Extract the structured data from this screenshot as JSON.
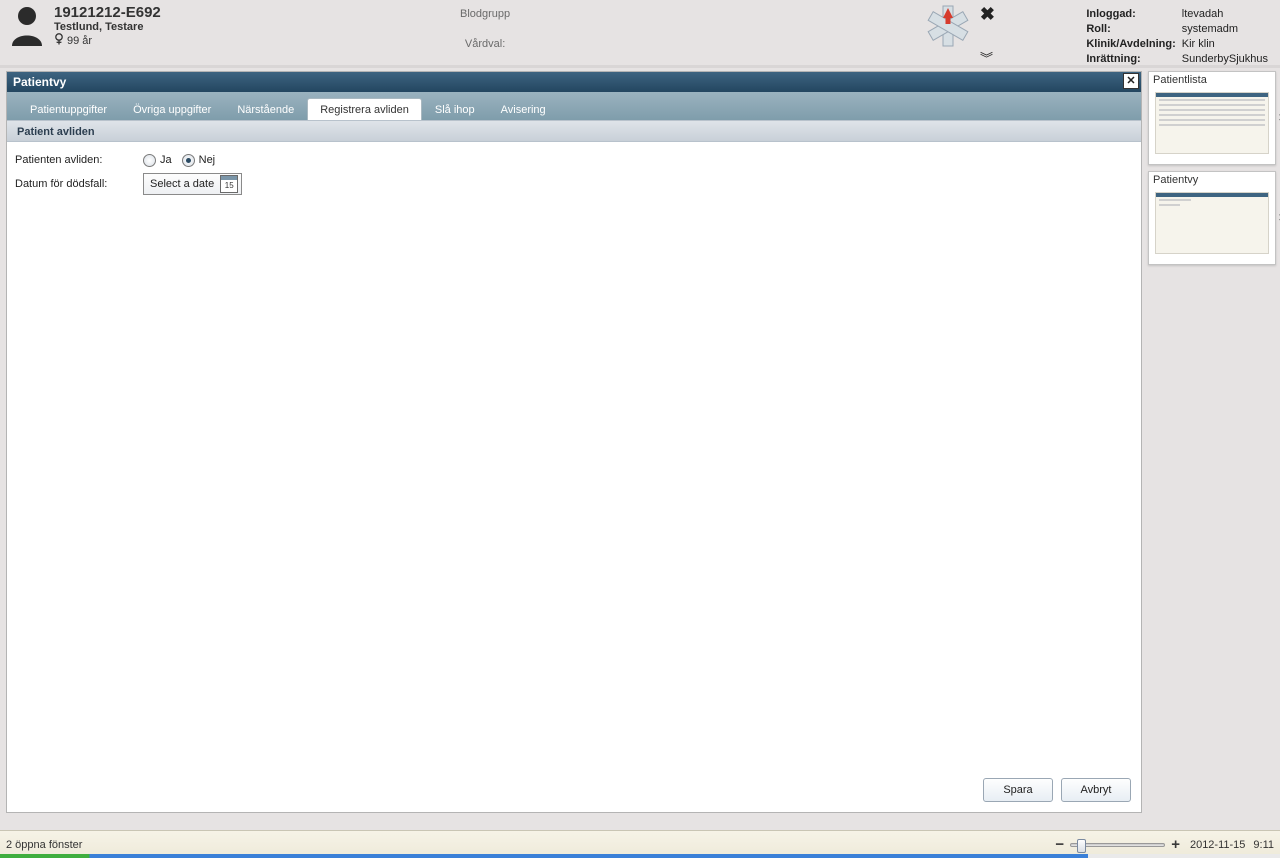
{
  "header": {
    "patient_id": "19121212-E692",
    "patient_name": "Testlund, Testare",
    "patient_age": "99 år",
    "blood_label": "Blodgrupp",
    "care_label": "Vårdval:"
  },
  "login": {
    "logged_label": "Inloggad:",
    "logged_value": "ltevadah",
    "role_label": "Roll:",
    "role_value": "systemadm",
    "clinic_label": "Klinik/Avdelning:",
    "clinic_value": "Kir klin",
    "facility_label": "Inrättning:",
    "facility_value": "SunderbySjukhus"
  },
  "workspace": {
    "title": "Patientvy",
    "tabs": [
      {
        "label": "Patientuppgifter"
      },
      {
        "label": "Övriga uppgifter"
      },
      {
        "label": "Närstående"
      },
      {
        "label": "Registrera avliden"
      },
      {
        "label": "Slå ihop"
      },
      {
        "label": "Avisering"
      }
    ],
    "section_header": "Patient avliden",
    "deceased_label": "Patienten avliden:",
    "radio_yes": "Ja",
    "radio_no": "Nej",
    "death_date_label": "Datum för dödsfall:",
    "date_placeholder": "Select a date",
    "cal_day": "15",
    "save_label": "Spara",
    "cancel_label": "Avbryt"
  },
  "side": {
    "panel1_title": "Patientlista",
    "panel2_title": "Patientvy"
  },
  "status": {
    "open_windows": "2 öppna fönster",
    "date": "2012-11-15",
    "time": "9:11"
  }
}
